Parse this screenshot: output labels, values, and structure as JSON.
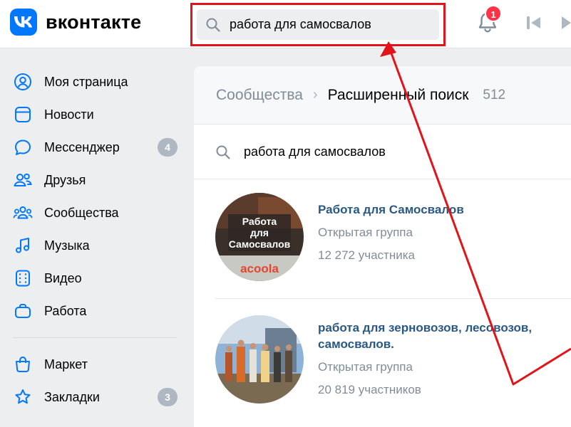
{
  "header": {
    "logo_text": "вконтакте",
    "search_query": "работа для самосвалов",
    "notification_count": "1"
  },
  "sidebar": {
    "items": [
      {
        "label": "Моя страница",
        "icon": "user-circle-icon"
      },
      {
        "label": "Новости",
        "icon": "news-icon"
      },
      {
        "label": "Мессенджер",
        "icon": "message-icon",
        "count": "4"
      },
      {
        "label": "Друзья",
        "icon": "friends-icon"
      },
      {
        "label": "Сообщества",
        "icon": "communities-icon"
      },
      {
        "label": "Музыка",
        "icon": "music-icon"
      },
      {
        "label": "Видео",
        "icon": "video-icon"
      },
      {
        "label": "Работа",
        "icon": "briefcase-icon"
      }
    ],
    "items2": [
      {
        "label": "Маркет",
        "icon": "bag-icon"
      },
      {
        "label": "Закладки",
        "icon": "star-icon",
        "count": "3"
      }
    ]
  },
  "main": {
    "breadcrumb_link": "Сообщества",
    "breadcrumb_current": "Расширенный поиск",
    "result_count": "512",
    "search_query": "работа для самосвалов",
    "groups": [
      {
        "name": "Работа для Самосвалов",
        "type": "Открытая группа",
        "members": "12 272 участника",
        "avatar_text": [
          "Работа",
          "для",
          "Самосвалов"
        ],
        "avatar_brand": "acoola"
      },
      {
        "name": "работа для зерновозов, лесовозов, самосвалов.",
        "type": "Открытая группа",
        "members": "20 819 участников"
      }
    ]
  },
  "colors": {
    "accent": "#0077ff",
    "link": "#2a5885",
    "secondary_text": "#818c99",
    "annotation": "#e1141a"
  }
}
